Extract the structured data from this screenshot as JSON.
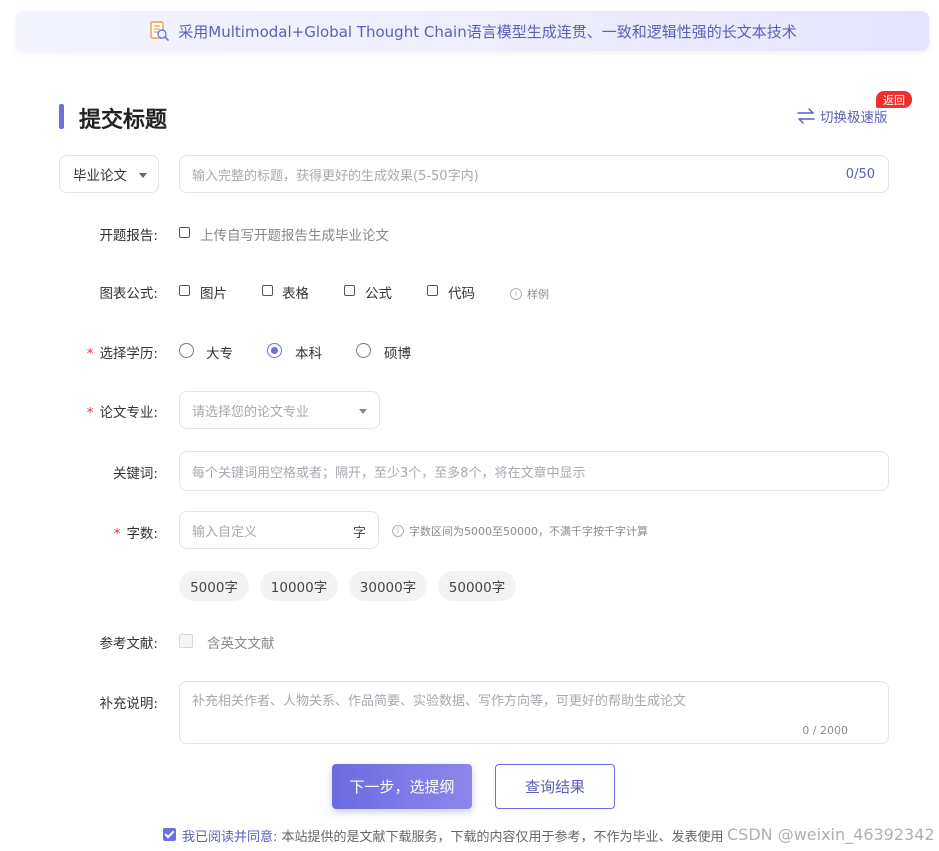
{
  "banner": {
    "icon": "document-search-icon",
    "text": "采用Multimodal+Global Thought Chain语言模型生成连贯、一致和逻辑性强的长文本技术"
  },
  "header": {
    "title": "提交标题",
    "switch_label": "切换极速版",
    "switch_icon": "swap-arrows-icon",
    "back_badge": "返回"
  },
  "title_row": {
    "type_value": "毕业论文",
    "title_placeholder": "输入完整的标题，获得更好的生成效果(5-50字内)",
    "char_count": "0/50"
  },
  "proposal": {
    "label": "开题报告:",
    "option": "上传自写开题报告生成毕业论文"
  },
  "figures": {
    "label": "图表公式:",
    "options": [
      "图片",
      "表格",
      "公式",
      "代码"
    ],
    "example_hint": "样例"
  },
  "degree": {
    "label": "选择学历:",
    "options": [
      "大专",
      "本科",
      "硕博"
    ],
    "selected": "本科"
  },
  "major": {
    "label": "论文专业:",
    "placeholder": "请选择您的论文专业"
  },
  "keywords": {
    "label": "关键词:",
    "placeholder": "每个关键词用空格或者；隔开，至少3个，至多8个，将在文章中显示"
  },
  "word_count": {
    "label": "字数:",
    "placeholder": "输入自定义",
    "unit": "字",
    "hint": "字数区间为5000至50000，不满千字按千字计算",
    "presets": [
      "5000字",
      "10000字",
      "30000字",
      "50000字"
    ]
  },
  "references": {
    "label": "参考文献:",
    "option": "含英文文献"
  },
  "supplement": {
    "label": "补充说明:",
    "placeholder": "补充相关作者、人物关系、作品简要、实验数据、写作方向等，可更好的帮助生成论文",
    "char_count": "0 / 2000"
  },
  "actions": {
    "next_label": "下一步，选提纲",
    "query_label": "查询结果"
  },
  "agreement": {
    "prefix": "我已阅读并同意:",
    "text": " 本站提供的是文献下载服务，下载的内容仅用于参考，不作为毕业、发表使用",
    "checked": true
  },
  "watermark": "CSDN @weixin_46392342",
  "colors": {
    "accent": "#6f6de0",
    "required": "#ef2e2e",
    "badge": "#ef2e2e"
  }
}
